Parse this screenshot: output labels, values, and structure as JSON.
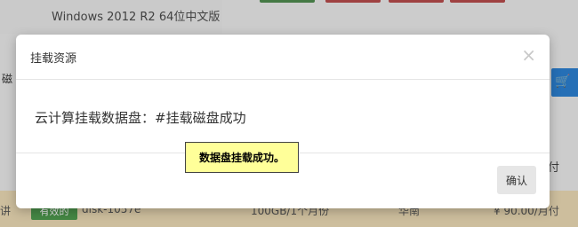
{
  "background": {
    "os_label": "Windows 2012 R2 64位中文版",
    "left_partial": "磁",
    "right_partial": "付",
    "row": {
      "col_a": "讲",
      "status_badge": "有效的",
      "disk_id": "disk-1057e",
      "capacity": "100GB/1个月份",
      "region": "华南",
      "price": "¥ 90.00/月付"
    }
  },
  "modal": {
    "title": "挂载资源",
    "close_symbol": "×",
    "message": "云计算挂载数据盘：#挂载磁盘成功",
    "confirm_label": "确认"
  },
  "toast": {
    "message": "数据盘挂载成功。"
  }
}
